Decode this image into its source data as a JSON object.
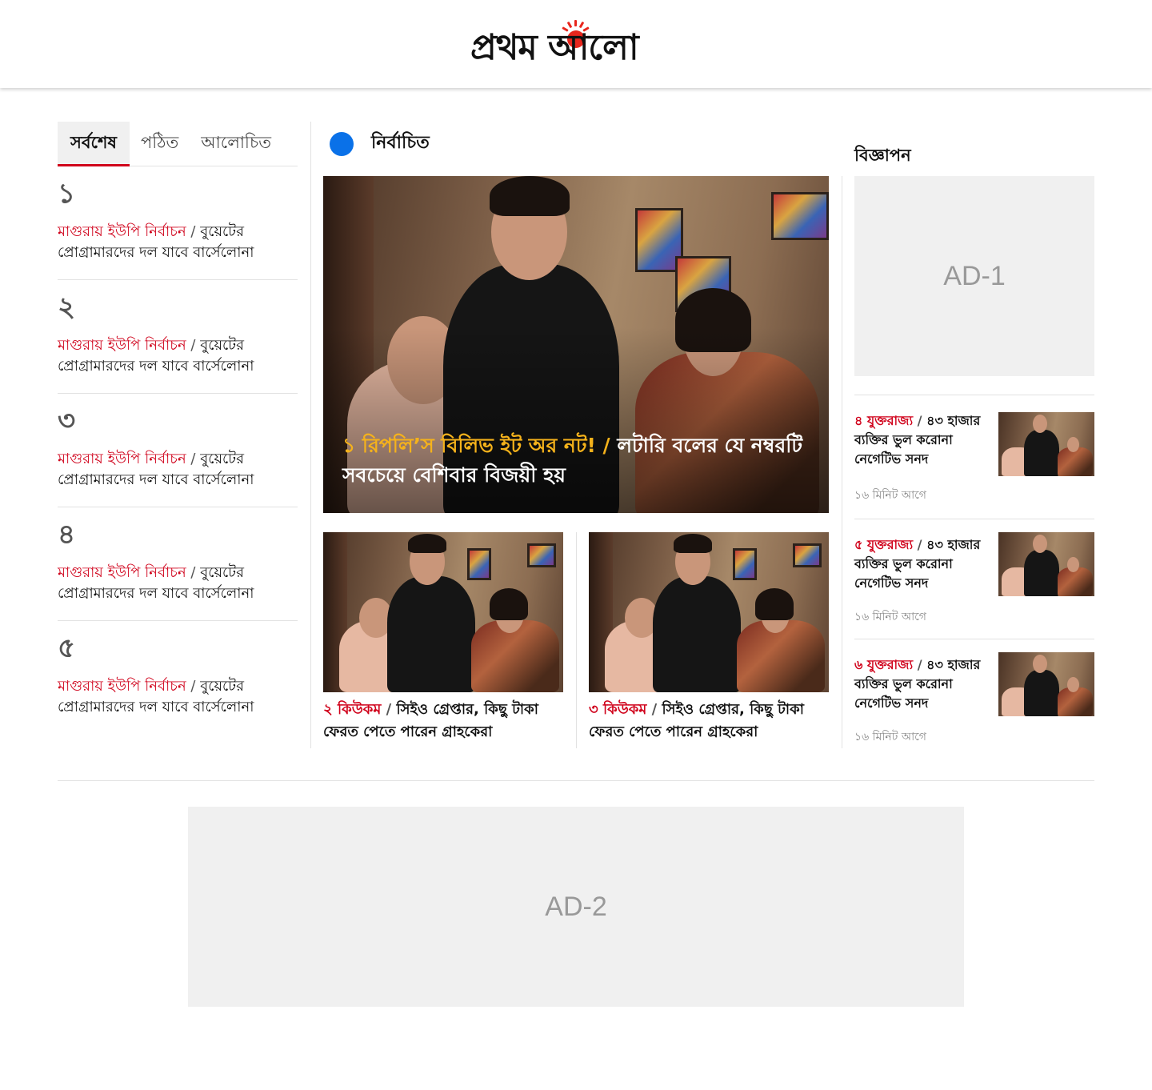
{
  "header": {
    "logo_text": "প্রথম আলো"
  },
  "left": {
    "tabs": [
      {
        "label": "সর্বশেষ",
        "active": true
      },
      {
        "label": "পঠিত",
        "active": false
      },
      {
        "label": "আলোচিত",
        "active": false
      }
    ],
    "items": [
      {
        "num": "১",
        "kicker": "মাগুরায় ইউপি নির্বাচন",
        "sep": " / ",
        "title": "বুয়েটের প্রোগ্রামারদের দল যাবে বার্সেলোনা"
      },
      {
        "num": "২",
        "kicker": "মাগুরায় ইউপি নির্বাচন",
        "sep": " / ",
        "title": "বুয়েটের প্রোগ্রামারদের দল যাবে বার্সেলোনা"
      },
      {
        "num": "৩",
        "kicker": "মাগুরায় ইউপি নির্বাচন",
        "sep": " / ",
        "title": "বুয়েটের প্রোগ্রামারদের দল যাবে বার্সেলোনা"
      },
      {
        "num": "৪",
        "kicker": "মাগুরায় ইউপি নির্বাচন",
        "sep": " / ",
        "title": "বুয়েটের প্রোগ্রামারদের দল যাবে বার্সেলোনা"
      },
      {
        "num": "৫",
        "kicker": "মাগুরায় ইউপি নির্বাচন",
        "sep": " / ",
        "title": "বুয়েটের প্রোগ্রামারদের দল যাবে বার্সেলোনা"
      }
    ]
  },
  "selected": {
    "title": "নির্বাচিত",
    "hero": {
      "kicker": "১ রিপলি’স বিলিভ ইট অর নট! / ",
      "title": "লটারি বলের যে নম্বরটি সবচেয়ে বেশিবার বিজয়ী হয়"
    },
    "cards": [
      {
        "kicker": "২ কিউকম",
        "sep": " / ",
        "title": "সিইও গ্রেপ্তার, কিছু টাকা ফেরত পেতে পারেন গ্রাহকেরা"
      },
      {
        "kicker": "৩ কিউকম",
        "sep": " / ",
        "title": "সিইও গ্রেপ্তার, কিছু টাকা ফেরত পেতে পারেন গ্রাহকেরা"
      }
    ]
  },
  "right": {
    "ad_label": "বিজ্ঞাপন",
    "ad1": "AD-1",
    "items": [
      {
        "kicker": "৪ যুক্তরাজ্য",
        "sep": " / ",
        "title": "৪৩ হাজার ব্যক্তির ভুল করোনা নেগেটিভ সনদ",
        "time": "১৬ মিনিট আগে"
      },
      {
        "kicker": "৫ যুক্তরাজ্য",
        "sep": " / ",
        "title": "৪৩ হাজার ব্যক্তির ভুল করোনা নেগেটিভ সনদ",
        "time": "১৬ মিনিট আগে"
      },
      {
        "kicker": "৬ যুক্তরাজ্য",
        "sep": " / ",
        "title": "৪৩ হাজার ব্যক্তির ভুল করোনা নেগেটিভ সনদ",
        "time": "১৬ মিনিট আগে"
      }
    ]
  },
  "ad2": "AD-2",
  "colors": {
    "accent_red": "#d0021b",
    "hero_kicker": "#f5b21b",
    "selected_dot": "#0a71e8",
    "logo_sun": "#e8261d"
  }
}
